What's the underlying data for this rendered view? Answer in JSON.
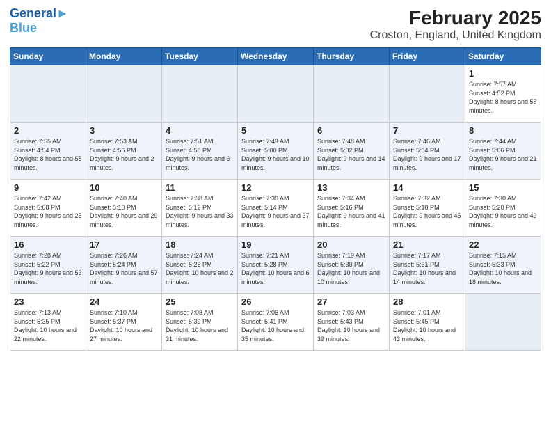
{
  "header": {
    "logo_line1": "General",
    "logo_line2": "Blue",
    "title": "February 2025",
    "subtitle": "Croston, England, United Kingdom"
  },
  "days_of_week": [
    "Sunday",
    "Monday",
    "Tuesday",
    "Wednesday",
    "Thursday",
    "Friday",
    "Saturday"
  ],
  "weeks": [
    [
      {
        "day": "",
        "info": ""
      },
      {
        "day": "",
        "info": ""
      },
      {
        "day": "",
        "info": ""
      },
      {
        "day": "",
        "info": ""
      },
      {
        "day": "",
        "info": ""
      },
      {
        "day": "",
        "info": ""
      },
      {
        "day": "1",
        "info": "Sunrise: 7:57 AM\nSunset: 4:52 PM\nDaylight: 8 hours and 55 minutes."
      }
    ],
    [
      {
        "day": "2",
        "info": "Sunrise: 7:55 AM\nSunset: 4:54 PM\nDaylight: 8 hours and 58 minutes."
      },
      {
        "day": "3",
        "info": "Sunrise: 7:53 AM\nSunset: 4:56 PM\nDaylight: 9 hours and 2 minutes."
      },
      {
        "day": "4",
        "info": "Sunrise: 7:51 AM\nSunset: 4:58 PM\nDaylight: 9 hours and 6 minutes."
      },
      {
        "day": "5",
        "info": "Sunrise: 7:49 AM\nSunset: 5:00 PM\nDaylight: 9 hours and 10 minutes."
      },
      {
        "day": "6",
        "info": "Sunrise: 7:48 AM\nSunset: 5:02 PM\nDaylight: 9 hours and 14 minutes."
      },
      {
        "day": "7",
        "info": "Sunrise: 7:46 AM\nSunset: 5:04 PM\nDaylight: 9 hours and 17 minutes."
      },
      {
        "day": "8",
        "info": "Sunrise: 7:44 AM\nSunset: 5:06 PM\nDaylight: 9 hours and 21 minutes."
      }
    ],
    [
      {
        "day": "9",
        "info": "Sunrise: 7:42 AM\nSunset: 5:08 PM\nDaylight: 9 hours and 25 minutes."
      },
      {
        "day": "10",
        "info": "Sunrise: 7:40 AM\nSunset: 5:10 PM\nDaylight: 9 hours and 29 minutes."
      },
      {
        "day": "11",
        "info": "Sunrise: 7:38 AM\nSunset: 5:12 PM\nDaylight: 9 hours and 33 minutes."
      },
      {
        "day": "12",
        "info": "Sunrise: 7:36 AM\nSunset: 5:14 PM\nDaylight: 9 hours and 37 minutes."
      },
      {
        "day": "13",
        "info": "Sunrise: 7:34 AM\nSunset: 5:16 PM\nDaylight: 9 hours and 41 minutes."
      },
      {
        "day": "14",
        "info": "Sunrise: 7:32 AM\nSunset: 5:18 PM\nDaylight: 9 hours and 45 minutes."
      },
      {
        "day": "15",
        "info": "Sunrise: 7:30 AM\nSunset: 5:20 PM\nDaylight: 9 hours and 49 minutes."
      }
    ],
    [
      {
        "day": "16",
        "info": "Sunrise: 7:28 AM\nSunset: 5:22 PM\nDaylight: 9 hours and 53 minutes."
      },
      {
        "day": "17",
        "info": "Sunrise: 7:26 AM\nSunset: 5:24 PM\nDaylight: 9 hours and 57 minutes."
      },
      {
        "day": "18",
        "info": "Sunrise: 7:24 AM\nSunset: 5:26 PM\nDaylight: 10 hours and 2 minutes."
      },
      {
        "day": "19",
        "info": "Sunrise: 7:21 AM\nSunset: 5:28 PM\nDaylight: 10 hours and 6 minutes."
      },
      {
        "day": "20",
        "info": "Sunrise: 7:19 AM\nSunset: 5:30 PM\nDaylight: 10 hours and 10 minutes."
      },
      {
        "day": "21",
        "info": "Sunrise: 7:17 AM\nSunset: 5:31 PM\nDaylight: 10 hours and 14 minutes."
      },
      {
        "day": "22",
        "info": "Sunrise: 7:15 AM\nSunset: 5:33 PM\nDaylight: 10 hours and 18 minutes."
      }
    ],
    [
      {
        "day": "23",
        "info": "Sunrise: 7:13 AM\nSunset: 5:35 PM\nDaylight: 10 hours and 22 minutes."
      },
      {
        "day": "24",
        "info": "Sunrise: 7:10 AM\nSunset: 5:37 PM\nDaylight: 10 hours and 27 minutes."
      },
      {
        "day": "25",
        "info": "Sunrise: 7:08 AM\nSunset: 5:39 PM\nDaylight: 10 hours and 31 minutes."
      },
      {
        "day": "26",
        "info": "Sunrise: 7:06 AM\nSunset: 5:41 PM\nDaylight: 10 hours and 35 minutes."
      },
      {
        "day": "27",
        "info": "Sunrise: 7:03 AM\nSunset: 5:43 PM\nDaylight: 10 hours and 39 minutes."
      },
      {
        "day": "28",
        "info": "Sunrise: 7:01 AM\nSunset: 5:45 PM\nDaylight: 10 hours and 43 minutes."
      },
      {
        "day": "",
        "info": ""
      }
    ]
  ]
}
